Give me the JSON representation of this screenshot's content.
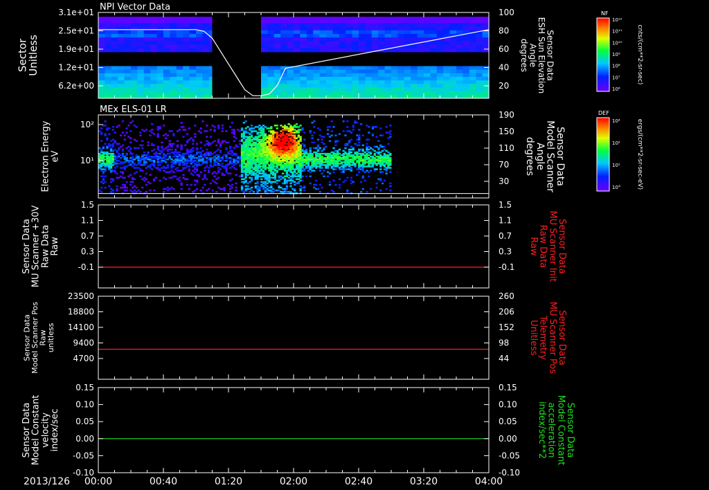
{
  "colors": {
    "background": "#000000",
    "axis": "#ffffff",
    "red_trace": "#ff2020",
    "green_trace": "#20e020",
    "label_red": "#ff2020",
    "label_green": "#20e020"
  },
  "footer": {
    "date": "2013/126",
    "time_ticks": [
      "00:00",
      "00:40",
      "01:20",
      "02:00",
      "02:40",
      "03:20",
      "04:00"
    ]
  },
  "chart_data": [
    {
      "type": "heatmap",
      "title": "NPI Vector Data",
      "ylabel": [
        "Sector",
        "Unitless"
      ],
      "yticks": [
        "3.1e+01",
        "2.5e+01",
        "1.9e+01",
        "1.2e+01",
        "6.2e+00"
      ],
      "y2label": [
        "Sensor Data",
        "ESH Sun Elevation",
        "Angle",
        "degrees"
      ],
      "y2ticks": [
        "100",
        "80",
        "60",
        "40",
        "20"
      ],
      "y2lim": [
        0,
        100
      ],
      "x_minutes": [
        0,
        240
      ],
      "gap_minutes": [
        70,
        100
      ],
      "overlay_line": {
        "name": "ESH Sun Elevation",
        "x": [
          0,
          60,
          65,
          70,
          75,
          80,
          85,
          90,
          95,
          100,
          105,
          110,
          115,
          240
        ],
        "y": [
          80,
          80,
          78,
          70,
          55,
          40,
          25,
          10,
          3,
          3,
          5,
          15,
          35,
          80
        ]
      },
      "colorbar": {
        "label": "NF",
        "units": "cnts/(cm**2-sr-sec)",
        "ticks": [
          "10¹²",
          "10¹¹",
          "10¹⁰",
          "10⁹",
          "10⁸",
          "10⁷",
          "10⁶"
        ]
      }
    },
    {
      "type": "heatmap",
      "title": "MEx ELS-01 LR",
      "ylabel": [
        "Electron Energy",
        "eV"
      ],
      "yticks": [
        "10²",
        "10¹"
      ],
      "y2label": [
        "Sensor Data",
        "Model Scanner",
        "Angle",
        "degrees"
      ],
      "y2ticks": [
        "190",
        "150",
        "110",
        "70",
        "30"
      ],
      "y2lim": [
        0,
        190
      ],
      "x_minutes": [
        0,
        240
      ],
      "data_end_minutes": 180,
      "overlay_line": {
        "name": "Model Scanner Angle",
        "x": [
          0,
          240
        ],
        "y": [
          10,
          10
        ]
      },
      "colorbar": {
        "label": "DEF",
        "units": "ergs/(cm**2-sr-sec-eV)",
        "ticks": [
          "10⁴",
          "10²",
          "10¹",
          "10°"
        ]
      }
    },
    {
      "type": "line",
      "ylabel": [
        "Sensor Data",
        "MU Scanner +30V",
        "Raw Data",
        "Raw"
      ],
      "yticks": [
        "1.5",
        "1.1",
        "0.7",
        "0.3",
        "-0.1"
      ],
      "ylim": [
        -0.5,
        1.5
      ],
      "y2label": [
        "Sensor Data",
        "MU Scanner Init",
        "Raw Data",
        "Raw"
      ],
      "y2ticks": [
        "1.5",
        "1.1",
        "0.7",
        "0.3",
        "-0.1"
      ],
      "series": [
        {
          "x": [
            0,
            240
          ],
          "y": [
            0,
            0
          ]
        }
      ]
    },
    {
      "type": "line",
      "ylabel": [
        "Sensor Data",
        "Model Scanner Pos",
        "Raw",
        "unitless"
      ],
      "yticks": [
        "23500",
        "18800",
        "14100",
        "9400",
        "4700"
      ],
      "ylim": [
        0,
        23500
      ],
      "y2label": [
        "Sensor Data",
        "MU Scanner Pos",
        "Telemetry",
        "Unitless"
      ],
      "y2ticks": [
        "260",
        "206",
        "152",
        "98",
        "44"
      ],
      "series": [
        {
          "x": [
            0,
            240
          ],
          "y": [
            8500,
            8500
          ]
        }
      ]
    },
    {
      "type": "line",
      "ylabel": [
        "Sensor Data",
        "Model Constant",
        "velocity",
        "index/sec"
      ],
      "yticks": [
        "0.15",
        "0.10",
        "0.05",
        "0.00",
        "-0.05",
        "-0.10"
      ],
      "ylim": [
        -0.1,
        0.15
      ],
      "y2label": [
        "Sensor Data",
        "Model Constant",
        "acceleration",
        "index/sec**2"
      ],
      "y2ticks": [
        "0.15",
        "0.10",
        "0.05",
        "0.00",
        "-0.05",
        "-0.10"
      ],
      "series": [
        {
          "x": [
            0,
            240
          ],
          "y": [
            0,
            0
          ]
        }
      ]
    }
  ]
}
